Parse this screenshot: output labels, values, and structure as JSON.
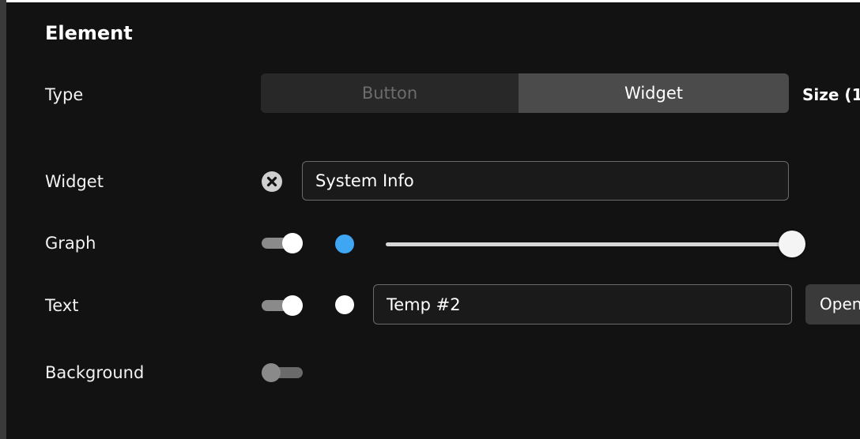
{
  "section": {
    "title": "Element"
  },
  "type_row": {
    "label": "Type",
    "options": [
      "Button",
      "Widget"
    ],
    "selected": "Widget",
    "size_label": "Size (1"
  },
  "widget_row": {
    "label": "Widget",
    "value": "System Info",
    "clear_icon": "close-circle-icon"
  },
  "graph_row": {
    "label": "Graph",
    "enabled": true,
    "color": "#3ea6f2",
    "slider_value_fraction": 1.0
  },
  "text_row": {
    "label": "Text",
    "enabled": true,
    "color": "#ffffff",
    "value": "Temp #2",
    "open_label": "Open"
  },
  "background_row": {
    "label": "Background",
    "enabled": false
  }
}
